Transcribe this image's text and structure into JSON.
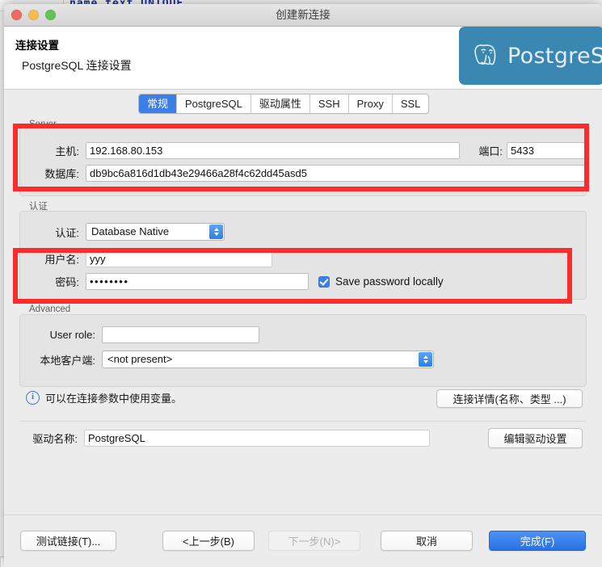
{
  "window": {
    "title": "创建新连接",
    "traffic_lights": [
      "close",
      "minimize",
      "zoom"
    ]
  },
  "background": {
    "code_text": "name text UNIQUE"
  },
  "header": {
    "title": "连接设置",
    "subtitle": "PostgreSQL 连接设置",
    "banner_text": "PostgreSQL",
    "banner_color": "#3a87b2"
  },
  "tabs": [
    {
      "label": "常规",
      "active": true
    },
    {
      "label": "PostgreSQL",
      "active": false
    },
    {
      "label": "驱动属性",
      "active": false
    },
    {
      "label": "SSH",
      "active": false
    },
    {
      "label": "Proxy",
      "active": false
    },
    {
      "label": "SSL",
      "active": false
    }
  ],
  "server": {
    "group_label": "Server",
    "host_label": "主机:",
    "host_value": "192.168.80.153",
    "port_label": "端口:",
    "port_value": "5433",
    "database_label": "数据库:",
    "database_value": "db9bc6a816d1db43e29466a28f4c62dd45asd5"
  },
  "authentication": {
    "group_label": "认证",
    "auth_label": "认证:",
    "auth_value": "Database Native",
    "username_label": "用户名:",
    "username_value": "yyy",
    "password_label": "密码:",
    "password_value": "••••••••",
    "save_password_label": "Save password locally",
    "save_password_checked": true
  },
  "advanced": {
    "group_label": "Advanced",
    "user_role_label": "User role:",
    "user_role_value": "",
    "local_client_label": "本地客户端:",
    "local_client_value": "<not present>"
  },
  "info": {
    "icon": "info-circle-icon",
    "text": "可以在连接参数中使用变量。",
    "details_button": "连接详情(名称、类型 ...)"
  },
  "driver": {
    "label": "驱动名称:",
    "value": "PostgreSQL",
    "edit_button": "编辑驱动设置"
  },
  "footer": {
    "test_connection": "测试链接(T)...",
    "back": "<上一步(B)",
    "next": "下一步(N)>",
    "cancel": "取消",
    "finish": "完成(F)",
    "next_disabled": true,
    "primary_color": "#2a72e4"
  },
  "annotations": {
    "color": "#fb2c2c",
    "boxes": [
      "server-fields",
      "credentials-fields"
    ]
  }
}
